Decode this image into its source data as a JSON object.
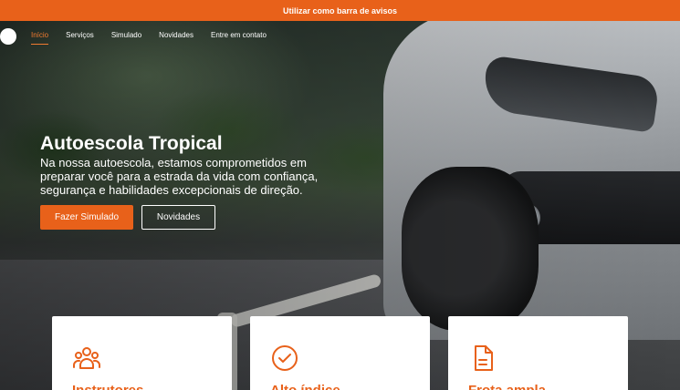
{
  "announcement": {
    "text": "Utilizar como barra de avisos"
  },
  "nav": {
    "items": [
      {
        "label": "Início",
        "active": true
      },
      {
        "label": "Serviços",
        "active": false
      },
      {
        "label": "Simulado",
        "active": false
      },
      {
        "label": "Novidades",
        "active": false
      },
      {
        "label": "Entre em contato",
        "active": false
      }
    ]
  },
  "hero": {
    "title": "Autoescola Tropical",
    "description": "Na nossa autoescola, estamos comprometidos em preparar você para a estrada da vida com confiança, segurança e habilidades excepcionais de direção.",
    "primary_button": "Fazer Simulado",
    "secondary_button": "Novidades"
  },
  "cards": [
    {
      "icon": "users-icon",
      "title": "Instrutores"
    },
    {
      "icon": "check-circle-icon",
      "title": "Alto índice"
    },
    {
      "icon": "document-icon",
      "title": "Frota ampla"
    }
  ],
  "colors": {
    "accent": "#e8611a",
    "announcement_bg": "#e8611a",
    "text_light": "#ffffff"
  }
}
